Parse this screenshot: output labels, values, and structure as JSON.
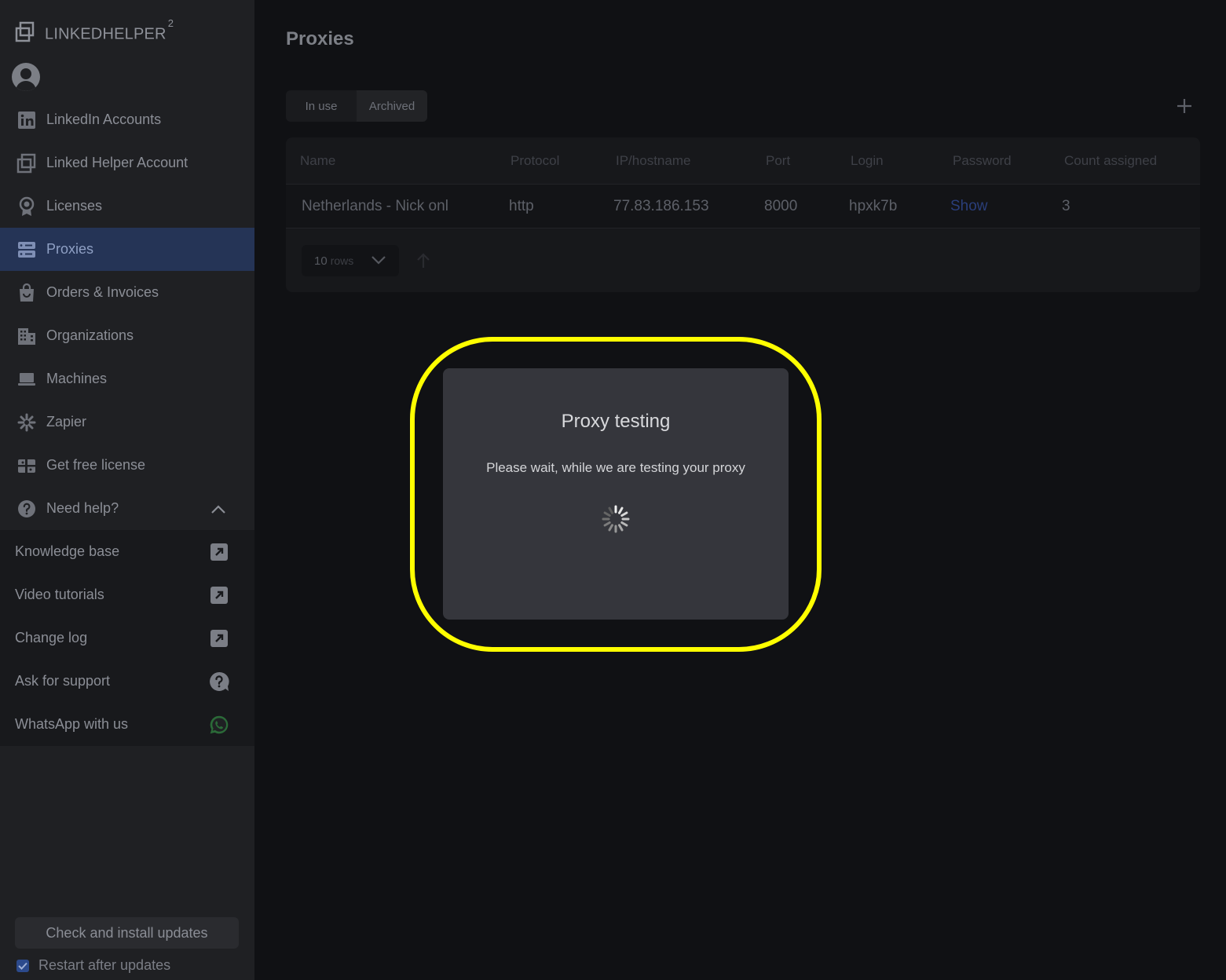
{
  "sidebar": {
    "brand": {
      "name": "LINKEDHELPER",
      "sup": "2"
    },
    "nav": [
      {
        "label": "LinkedIn Accounts",
        "icon": "linkedin-icon"
      },
      {
        "label": "Linked Helper Account",
        "icon": "linkedhelper-logo-icon"
      },
      {
        "label": "Licenses",
        "icon": "license-badge-icon"
      },
      {
        "label": "Proxies",
        "icon": "server-icon",
        "active": true
      },
      {
        "label": "Orders & Invoices",
        "icon": "shopping-bag-icon"
      },
      {
        "label": "Organizations",
        "icon": "building-icon"
      },
      {
        "label": "Machines",
        "icon": "laptop-icon"
      },
      {
        "label": "Zapier",
        "icon": "zapier-icon"
      },
      {
        "label": "Get free license",
        "icon": "gift-icon"
      },
      {
        "label": "Need help?",
        "icon": "question-circle-icon"
      }
    ],
    "help": [
      {
        "label": "Knowledge base",
        "icon": "external-link-icon"
      },
      {
        "label": "Video tutorials",
        "icon": "external-link-icon"
      },
      {
        "label": "Change log",
        "icon": "external-link-icon"
      },
      {
        "label": "Ask for support",
        "icon": "question-bubble-icon"
      },
      {
        "label": "WhatsApp with us",
        "icon": "whatsapp-icon"
      }
    ],
    "update_button": "Check and install updates",
    "restart_label": "Restart after updates",
    "restart_checked": true
  },
  "main": {
    "title": "Proxies",
    "tabs": [
      "In use",
      "Archived"
    ],
    "table": {
      "columns": [
        "Name",
        "Protocol",
        "IP/hostname",
        "Port",
        "Login",
        "Password",
        "Count assigned"
      ],
      "rows": [
        [
          "Netherlands - Nick onl",
          "http",
          "77.83.186.153",
          "8000",
          "hpxk7b",
          "Show",
          "3"
        ]
      ]
    },
    "pagination": {
      "rows_value": "10",
      "rows_label": "rows"
    }
  },
  "modal": {
    "title": "Proxy testing",
    "message": "Please wait, while we are testing your proxy"
  },
  "colors": {
    "active_nav": "#253456",
    "highlight": "#ffff00",
    "link": "#2a3e7a"
  }
}
